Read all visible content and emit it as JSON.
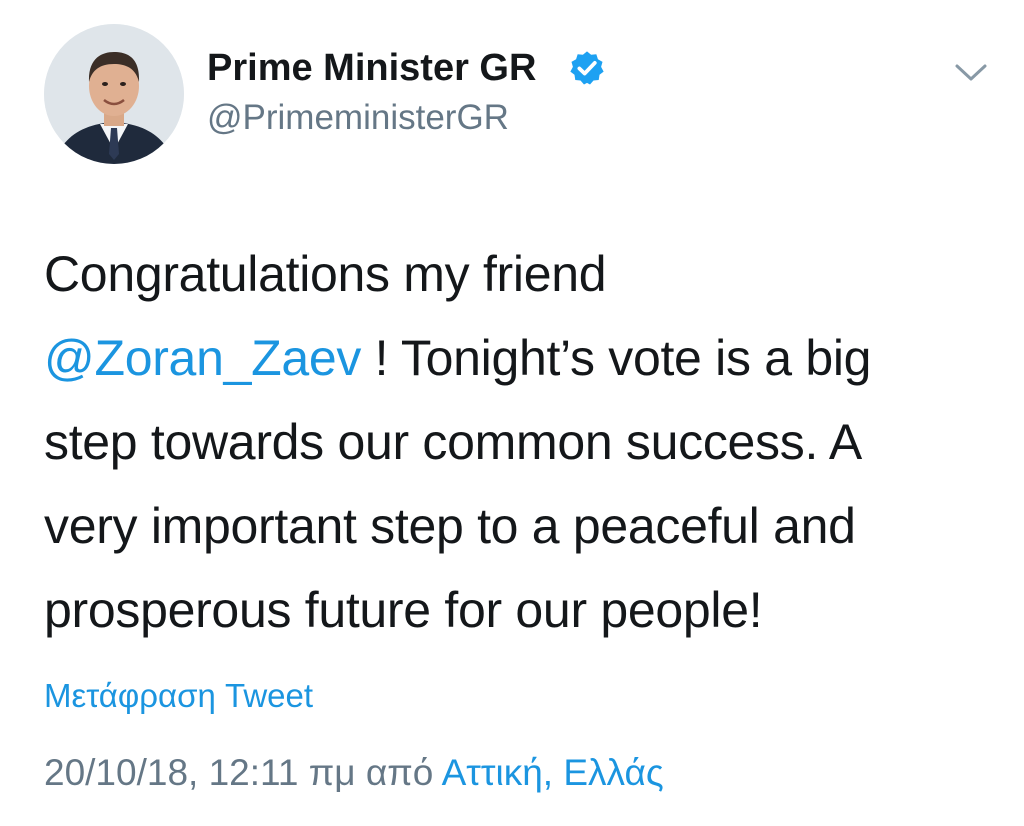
{
  "author": {
    "display_name": "Prime Minister GR",
    "handle": "@PrimeministerGR",
    "verified": true,
    "avatar_icon": "profile-photo"
  },
  "menu": {
    "icon": "chevron-down-icon"
  },
  "tweet": {
    "line1": "Congratulations my friend",
    "mention": "@Zoran_Zaev",
    "line2_rest": " ! Tonight’s vote is a big",
    "line3": "step towards our common success. A",
    "line4": "very important step to a peaceful and",
    "line5": "prosperous future for our people!"
  },
  "translate_label": "Μετάφραση Tweet",
  "meta": {
    "timestamp": "20/10/18, 12:11 πμ από ",
    "location": "Αττική, Ελλάς"
  },
  "colors": {
    "link": "#1b95e0",
    "secondary": "#657786",
    "text": "#14171a",
    "verified_badge": "#1da1f2"
  }
}
